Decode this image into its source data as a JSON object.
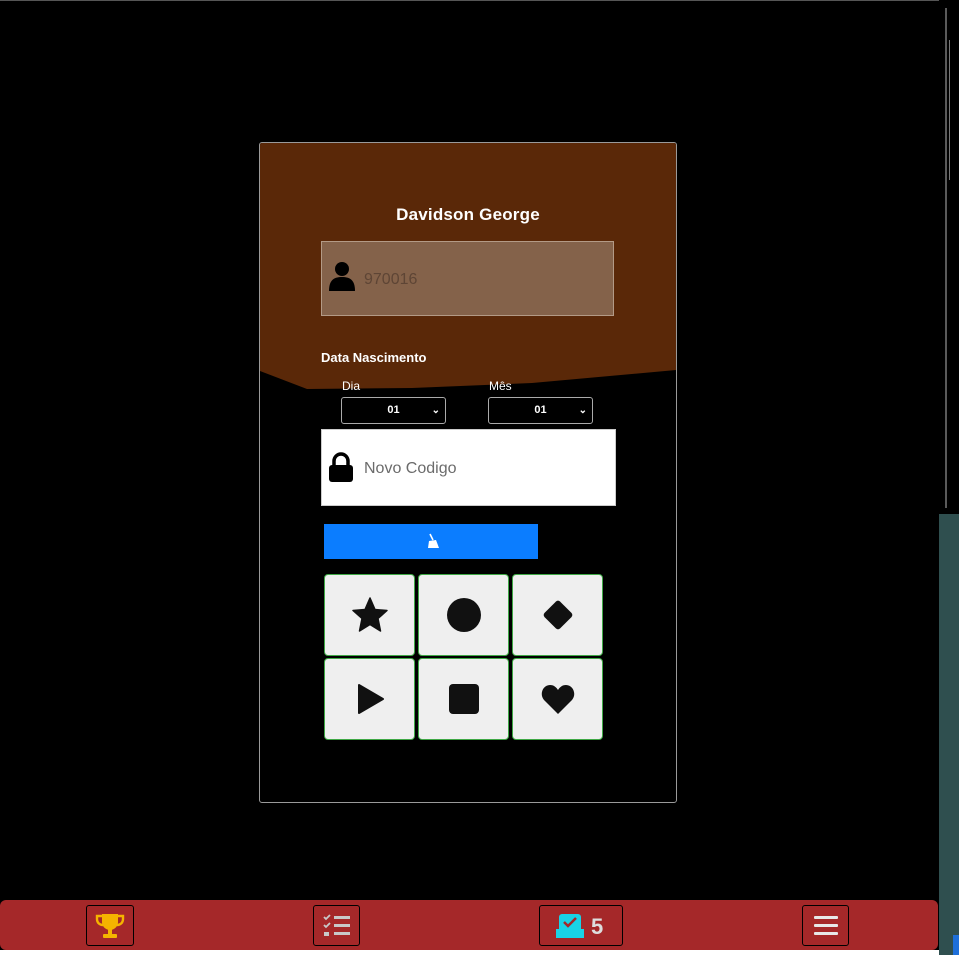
{
  "profile": {
    "name": "Davidson George",
    "id_value": "970016"
  },
  "birth": {
    "label": "Data Nascimento",
    "day_label": "Dia",
    "month_label": "Mês",
    "day_value": "01",
    "month_value": "01"
  },
  "code": {
    "placeholder": "Novo Codigo"
  },
  "shapes": [
    "star-icon",
    "circle-icon",
    "diamond-icon",
    "play-icon",
    "square-icon",
    "heart-icon"
  ],
  "nav": {
    "badge_count": "5",
    "icons": [
      "trophy-icon",
      "checklist-icon",
      "inbox-check-icon",
      "menu-icon"
    ]
  },
  "colors": {
    "header": "#5a2808",
    "accent": "#0b7dff",
    "bar": "#a52829",
    "trophy": "#f5b400",
    "inbox": "#19d3e6"
  }
}
